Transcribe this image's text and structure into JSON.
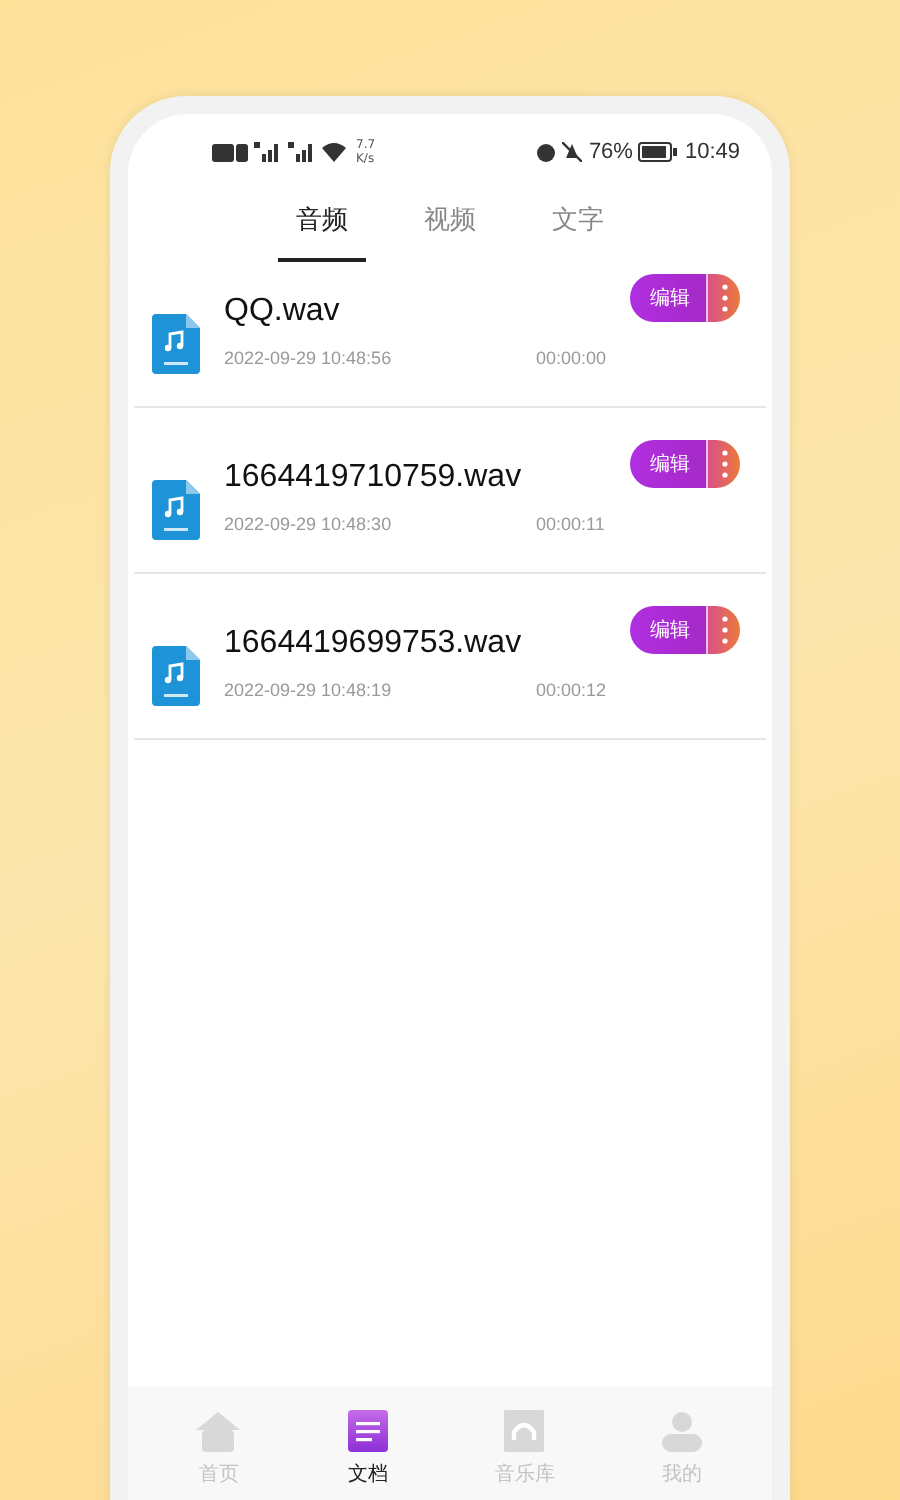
{
  "status_bar": {
    "speed": "7.7",
    "speed_unit": "K/s",
    "battery": "76%",
    "time": "10:49"
  },
  "tabs": [
    {
      "label": "音频",
      "selected": true
    },
    {
      "label": "视频",
      "selected": false
    },
    {
      "label": "文字",
      "selected": false
    }
  ],
  "files": [
    {
      "name": "QQ.wav",
      "date": "2022-09-29 10:48:56",
      "duration": "00:00:00",
      "action": "编辑"
    },
    {
      "name": "1664419710759.wav",
      "date": "2022-09-29 10:48:30",
      "duration": "00:00:11",
      "action": "编辑"
    },
    {
      "name": "1664419699753.wav",
      "date": "2022-09-29 10:48:19",
      "duration": "00:00:12",
      "action": "编辑"
    }
  ],
  "nav": [
    {
      "kind": "home",
      "label": "首页",
      "selected": false
    },
    {
      "kind": "document",
      "label": "文档",
      "selected": true
    },
    {
      "kind": "music",
      "label": "音乐库",
      "selected": false
    },
    {
      "kind": "person",
      "label": "我的",
      "selected": false
    }
  ]
}
